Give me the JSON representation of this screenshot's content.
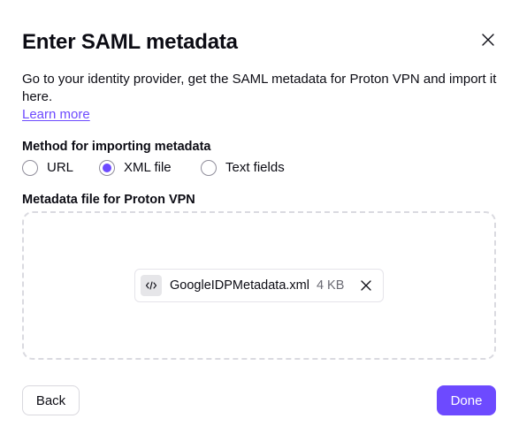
{
  "modal": {
    "title": "Enter SAML metadata",
    "close_icon": "close-icon",
    "description": "Go to your identity provider, get the SAML metadata for Proton VPN and import it here.",
    "learn_more": "Learn more"
  },
  "method": {
    "label": "Method for importing metadata",
    "options": [
      {
        "label": "URL",
        "checked": false
      },
      {
        "label": "XML file",
        "checked": true
      },
      {
        "label": "Text fields",
        "checked": false
      }
    ]
  },
  "file_section": {
    "label": "Metadata file for Proton VPN",
    "file": {
      "icon": "code-file-icon",
      "name": "GoogleIDPMetadata.xml",
      "size": "4 KB",
      "remove_icon": "close-icon"
    }
  },
  "footer": {
    "back_label": "Back",
    "done_label": "Done"
  },
  "colors": {
    "accent": "#6d4aff",
    "text": "#0c0c14",
    "muted": "#6a6a73",
    "border": "#dadae0"
  }
}
